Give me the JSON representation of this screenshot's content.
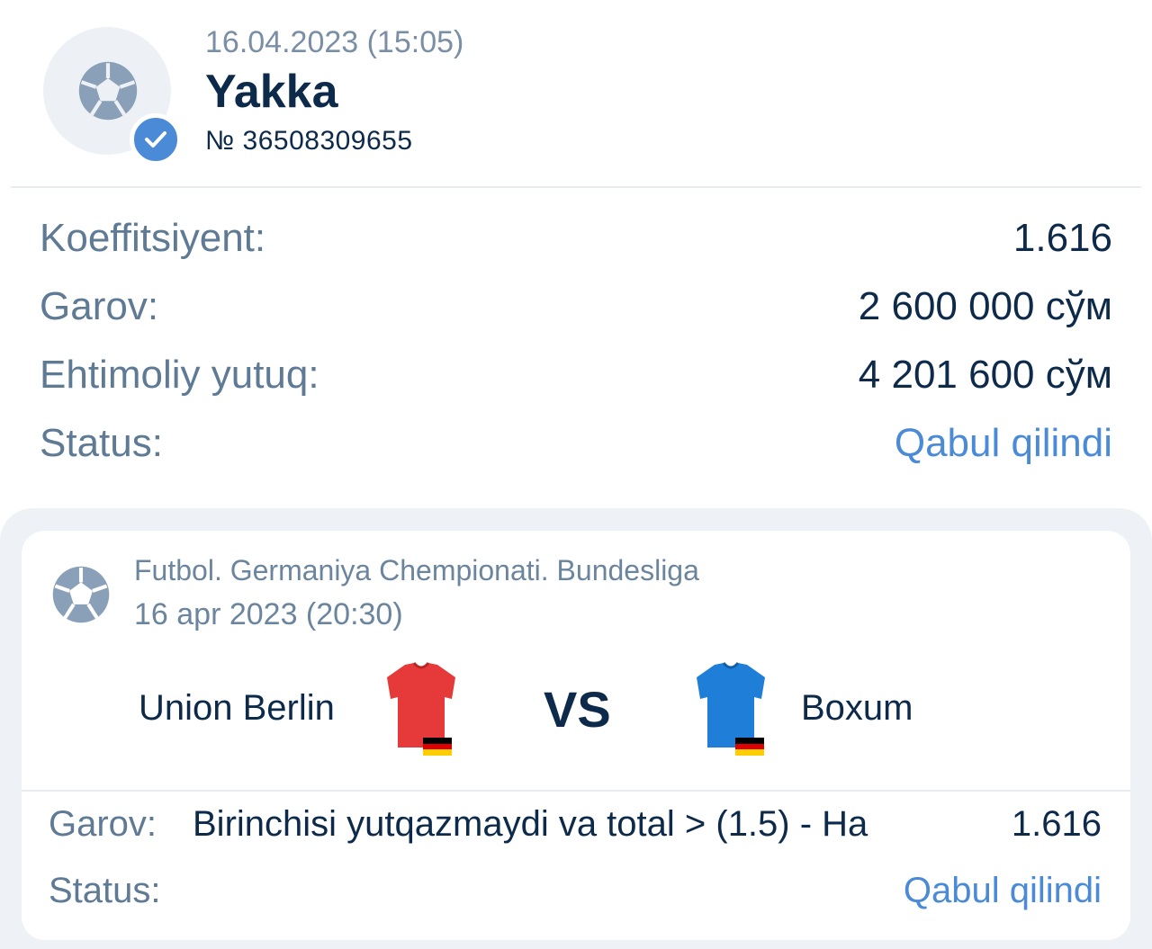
{
  "header": {
    "date": "16.04.2023 (15:05)",
    "title": "Yakka",
    "number": "№ 36508309655",
    "sport_icon": "soccer-ball-icon",
    "badge_icon": "check-icon"
  },
  "summary": {
    "rows": [
      {
        "label": "Koeffitsiyent:",
        "value": "1.616"
      },
      {
        "label": "Garov:",
        "value": "2 600 000 сўм"
      },
      {
        "label": "Ehtimoliy yutuq:",
        "value": "4 201 600 сўм"
      },
      {
        "label": "Status:",
        "value": "Qabul qilindi"
      }
    ]
  },
  "event": {
    "league": "Futbol. Germaniya Chempionati. Bundesliga",
    "date": "16 apr 2023 (20:30)",
    "home_team": "Union Berlin",
    "away_team": "Boxum",
    "vs": "VS",
    "home_jersey_color": "#e63a3a",
    "away_jersey_color": "#1f7fd8",
    "flag_icon": "germany-flag-icon",
    "bet_label": "Garov:",
    "bet_description": "Birinchisi yutqazmaydi va total > (1.5) - Ha",
    "bet_odds": "1.616",
    "status_label": "Status:",
    "status_value": "Qabul qilindi"
  },
  "colors": {
    "accent": "#4a8ad6",
    "text_dark": "#0d2a4a",
    "text_muted": "#5f7a94"
  }
}
